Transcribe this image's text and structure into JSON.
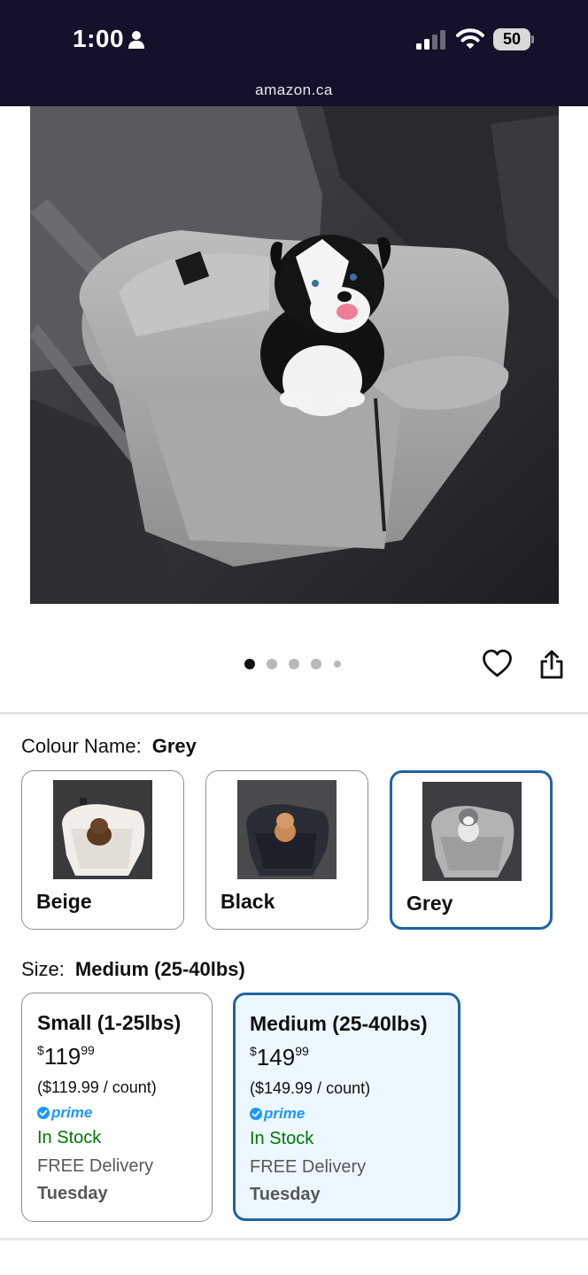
{
  "status_bar": {
    "time": "1:00",
    "battery": "50",
    "url": "amazon.ca"
  },
  "product": {
    "image_count": 5,
    "active_image": 0
  },
  "colour": {
    "label": "Colour Name:",
    "selected": "Grey",
    "options": [
      {
        "name": "Beige"
      },
      {
        "name": "Black"
      },
      {
        "name": "Grey"
      }
    ]
  },
  "size": {
    "label": "Size:",
    "selected": "Medium (25-40lbs)",
    "options": [
      {
        "title": "Small (1-25lbs)",
        "price_symbol": "$",
        "price_whole": "119",
        "price_cents": "99",
        "unit_price": "($119.99 / count)",
        "prime": "prime",
        "stock": "In Stock",
        "delivery": "FREE Delivery",
        "day": "Tuesday"
      },
      {
        "title": "Medium (25-40lbs)",
        "price_symbol": "$",
        "price_whole": "149",
        "price_cents": "99",
        "unit_price": "($149.99 / count)",
        "prime": "prime",
        "stock": "In Stock",
        "delivery": "FREE Delivery",
        "day": "Tuesday"
      }
    ]
  },
  "colors": {
    "status_bar_bg": "#14112a",
    "selected_border": "#2162a1",
    "selected_bg": "#edf7ff",
    "stock_green": "#007600",
    "prime_blue": "#1a98ff"
  }
}
